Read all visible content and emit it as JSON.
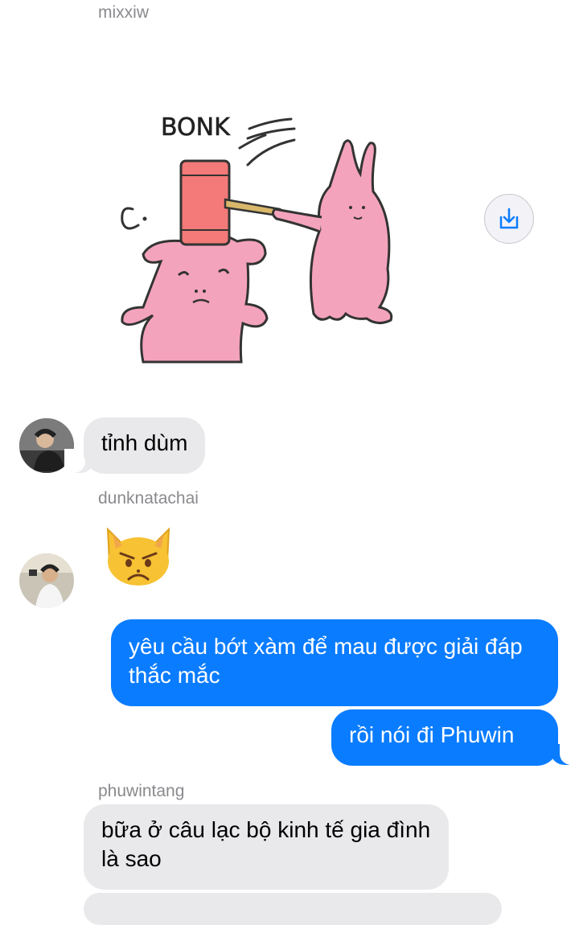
{
  "messages": {
    "sender_1": "mixxiw",
    "sticker_text": "BONK",
    "msg_1": "tỉnh dùm",
    "sender_2": "dunknatachai",
    "emoji_2": "😾",
    "out_1": "yêu cầu bớt xàm để mau được giải đáp thắc mắc",
    "out_2": "rồi nói đi Phuwin",
    "sender_3": "phuwintang",
    "msg_3": "bữa ở câu lạc bộ kinh tế gia đình là sao"
  },
  "icons": {
    "save": "download-icon"
  },
  "colors": {
    "outgoing_bubble": "#0a7cff",
    "incoming_bubble": "#e9e9eb",
    "sender_label": "#8a8a8e"
  }
}
